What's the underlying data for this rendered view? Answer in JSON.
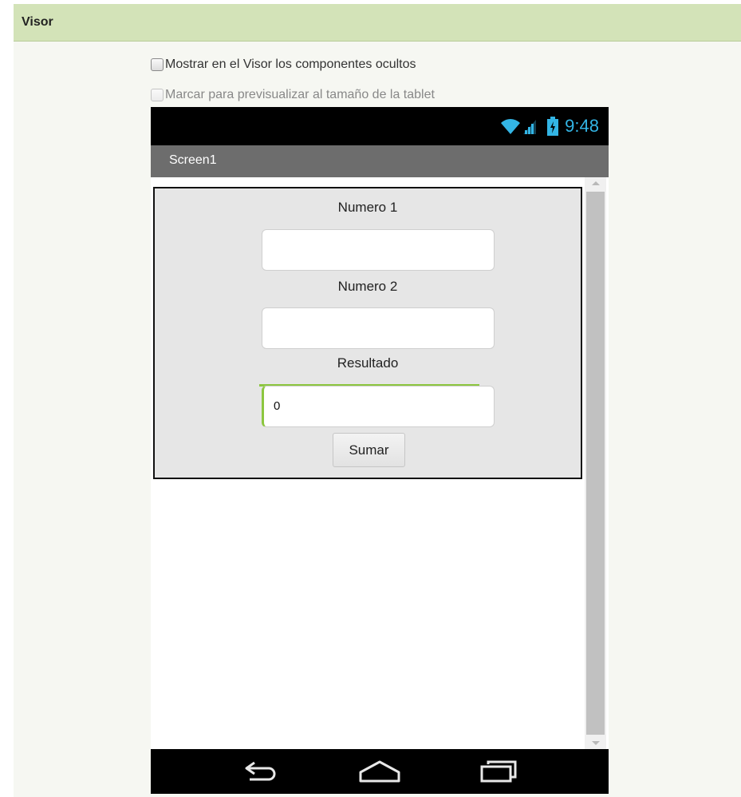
{
  "panel": {
    "title": "Visor",
    "options": [
      {
        "label": "Mostrar en el Visor los componentes ocultos",
        "checked": false,
        "enabled": true
      },
      {
        "label": "Marcar para previsualizar al tamaño de la tablet",
        "checked": false,
        "enabled": false
      }
    ]
  },
  "phone": {
    "status_time": "9:48",
    "status_icons": [
      "wifi-icon",
      "signal-icon",
      "battery-charging-icon"
    ],
    "screen_title": "Screen1",
    "form": {
      "label1": "Numero 1",
      "input1_value": "",
      "label2": "Numero 2",
      "input2_value": "",
      "label3": "Resultado",
      "result_value": "0",
      "button_label": "Sumar"
    },
    "nav_icons": [
      "back-icon",
      "home-icon",
      "recent-apps-icon"
    ]
  },
  "colors": {
    "header_bg": "#d3e3b8",
    "panel_bg": "#f6f7f2",
    "title_bar": "#6d6d6d",
    "status_accent": "#33b5e5",
    "focus_accent": "#8cc63f"
  }
}
